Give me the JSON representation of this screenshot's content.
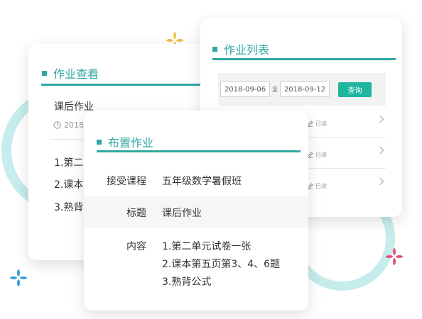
{
  "view_card": {
    "title": "作业查看",
    "heading": "课后作业",
    "date": "2018-",
    "lines": [
      "1.第二",
      "2.课本",
      "3.熟背"
    ]
  },
  "list_card": {
    "title": "作业列表",
    "filter": {
      "start_date": "2018-09-06",
      "separator": "至",
      "end_date": "2018-09-12",
      "query_label": "查询"
    },
    "rows": [
      {
        "status": "已读"
      },
      {
        "status": "已读"
      },
      {
        "status": "已读"
      }
    ]
  },
  "assign_card": {
    "title": "布置作业",
    "course_label": "接受课程",
    "course_value": "五年级数学暑假班",
    "title_label": "标题",
    "title_value": "课后作业",
    "content_label": "内容",
    "content_lines": [
      "1.第二单元试卷一张",
      "2.课本第五页第3、4、6题",
      "3.熟背公式"
    ]
  },
  "colors": {
    "accent": "#2fa7a2",
    "button": "#1fb59e",
    "ring": "#c6ecec",
    "sparkle_yellow": "#f4c24a",
    "sparkle_pink": "#e8507a",
    "sparkle_blue": "#3a9fd8"
  }
}
